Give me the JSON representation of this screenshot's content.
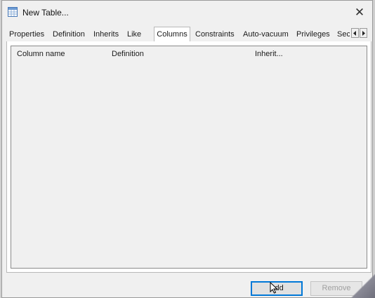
{
  "window": {
    "title": "New Table...",
    "close_symbol": "✕"
  },
  "tabs": [
    {
      "label": "Properties",
      "active": false
    },
    {
      "label": "Definition",
      "active": false
    },
    {
      "label": "Inherits",
      "active": false
    },
    {
      "label": "Like",
      "active": false
    },
    {
      "label": "Columns",
      "active": true
    },
    {
      "label": "Constraints",
      "active": false
    },
    {
      "label": "Auto-vacuum",
      "active": false
    },
    {
      "label": "Privileges",
      "active": false
    },
    {
      "label": "Sec",
      "active": false
    }
  ],
  "tab_scroll": {
    "left_icon": "arrow-left-icon",
    "right_icon": "arrow-right-icon"
  },
  "columns_list": {
    "headers": [
      "Column name",
      "Definition",
      "Inherit..."
    ],
    "rows": []
  },
  "buttons": {
    "add_label": "Add",
    "remove_label": "Remove"
  },
  "colors": {
    "focus_border": "#0078d7",
    "dialog_bg": "#f0f0f0"
  }
}
